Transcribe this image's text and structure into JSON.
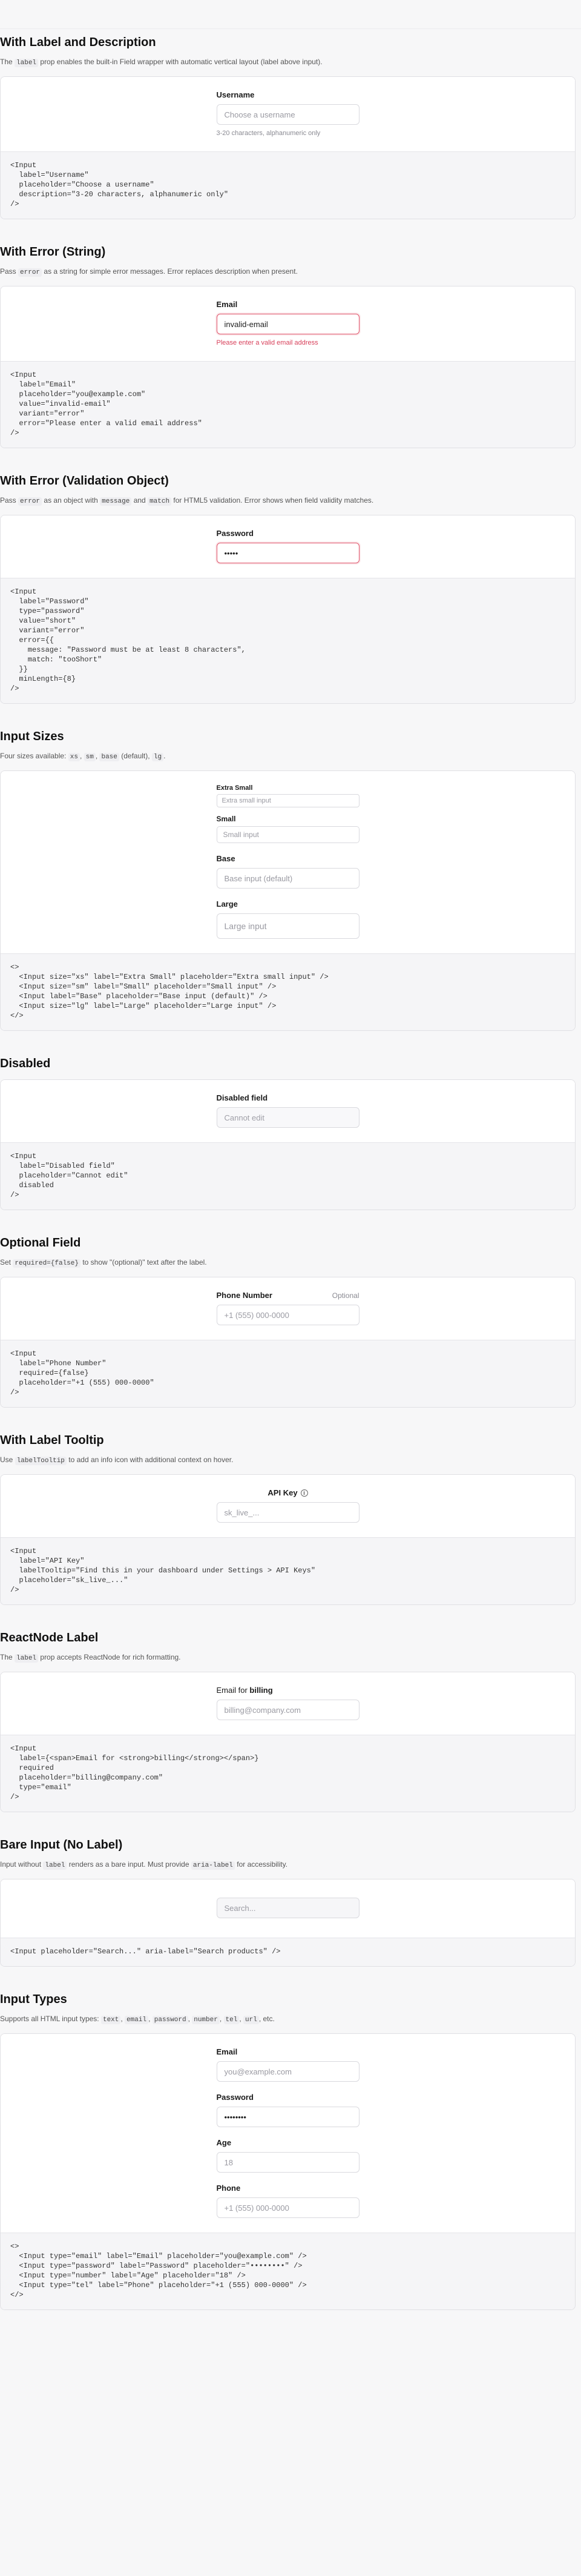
{
  "sections": {
    "label_desc": {
      "title": "With Label and Description",
      "desc_pre": "The",
      "desc_code": "label",
      "desc_post": "prop enables the built-in Field wrapper with automatic vertical layout (label above input).",
      "label": "Username",
      "placeholder": "Choose a username",
      "hint": "3-20 characters, alphanumeric only",
      "code": [
        "<Input",
        "  label=\"Username\"",
        "  placeholder=\"Choose a username\"",
        "  description=\"3-20 characters, alphanumeric only\"",
        "/>"
      ]
    },
    "error_string": {
      "title": "With Error (String)",
      "desc_pre": "Pass",
      "desc_code": "error",
      "desc_post": "as a string for simple error messages. Error replaces description when present.",
      "label": "Email",
      "value": "invalid-email",
      "error": "Please enter a valid email address",
      "code": [
        "<Input",
        "  label=\"Email\"",
        "  placeholder=\"you@example.com\"",
        "  value=\"invalid-email\"",
        "  variant=\"error\"",
        "  error=\"Please enter a valid email address\"",
        "/>"
      ]
    },
    "error_object": {
      "title": "With Error (Validation Object)",
      "desc_pre": "Pass",
      "desc_code": "error",
      "desc_mid1": "as an object with",
      "desc_code2": "message",
      "desc_mid2": "and",
      "desc_code3": "match",
      "desc_post": "for HTML5 validation. Error shows when field validity matches.",
      "label": "Password",
      "value": "•••••",
      "code": [
        "<Input",
        "  label=\"Password\"",
        "  type=\"password\"",
        "  value=\"short\"",
        "  variant=\"error\"",
        "  error={{",
        "    message: \"Password must be at least 8 characters\",",
        "    match: \"tooShort\"",
        "  }}",
        "  minLength={8}",
        "/>"
      ]
    },
    "sizes": {
      "title": "Input Sizes",
      "desc_pre": "Four sizes available:",
      "desc_c1": "xs",
      "desc_c2": "sm",
      "desc_c3": "base",
      "desc_mid": "(default),",
      "desc_c4": "lg",
      "desc_post": ".",
      "xs_label": "Extra Small",
      "xs_placeholder": "Extra small input",
      "sm_label": "Small",
      "sm_placeholder": "Small input",
      "base_label": "Base",
      "base_placeholder": "Base input (default)",
      "lg_label": "Large",
      "lg_placeholder": "Large input",
      "code": [
        "<>",
        "  <Input size=\"xs\" label=\"Extra Small\" placeholder=\"Extra small input\" />",
        "  <Input size=\"sm\" label=\"Small\" placeholder=\"Small input\" />",
        "  <Input label=\"Base\" placeholder=\"Base input (default)\" />",
        "  <Input size=\"lg\" label=\"Large\" placeholder=\"Large input\" />",
        "</>"
      ]
    },
    "disabled": {
      "title": "Disabled",
      "label": "Disabled field",
      "placeholder": "Cannot edit",
      "code": [
        "<Input",
        "  label=\"Disabled field\"",
        "  placeholder=\"Cannot edit\"",
        "  disabled",
        "/>"
      ]
    },
    "optional": {
      "title": "Optional Field",
      "desc_pre": "Set",
      "desc_code": "required={false}",
      "desc_post": "to show \"(optional)\" text after the label.",
      "label": "Phone Number",
      "optional_text": "Optional",
      "placeholder": "+1 (555) 000-0000",
      "code": [
        "<Input",
        "  label=\"Phone Number\"",
        "  required={false}",
        "  placeholder=\"+1 (555) 000-0000\"",
        "/>"
      ]
    },
    "tooltip": {
      "title": "With Label Tooltip",
      "desc_pre": "Use",
      "desc_code": "labelTooltip",
      "desc_post": "to add an info icon with additional context on hover.",
      "label": "API Key",
      "placeholder": "sk_live_...",
      "code": [
        "<Input",
        "  label=\"API Key\"",
        "  labelTooltip=\"Find this in your dashboard under Settings > API Keys\"",
        "  placeholder=\"sk_live_...\"",
        "/>"
      ]
    },
    "reactnode": {
      "title": "ReactNode Label",
      "desc_pre": "The",
      "desc_code": "label",
      "desc_post": "prop accepts ReactNode for rich formatting.",
      "label_pre": "Email for",
      "label_strong": "billing",
      "placeholder": "billing@company.com",
      "code": [
        "<Input",
        "  label={<span>Email for <strong>billing</strong></span>}",
        "  required",
        "  placeholder=\"billing@company.com\"",
        "  type=\"email\"",
        "/>"
      ]
    },
    "bare": {
      "title": "Bare Input (No Label)",
      "desc_pre": "Input without",
      "desc_code": "label",
      "desc_mid": "renders as a bare input. Must provide",
      "desc_code2": "aria-label",
      "desc_post": "for accessibility.",
      "placeholder": "Search...",
      "code": [
        "<Input placeholder=\"Search...\" aria-label=\"Search products\" />"
      ]
    },
    "types": {
      "title": "Input Types",
      "desc_pre": "Supports all HTML input types:",
      "desc_c1": "text",
      "desc_c2": "email",
      "desc_c3": "password",
      "desc_c4": "number",
      "desc_c5": "tel",
      "desc_c6": "url",
      "desc_post": ", etc.",
      "email_label": "Email",
      "email_placeholder": "you@example.com",
      "password_label": "Password",
      "password_value": "••••••••",
      "age_label": "Age",
      "age_placeholder": "18",
      "phone_label": "Phone",
      "phone_placeholder": "+1 (555) 000-0000",
      "code": [
        "<>",
        "  <Input type=\"email\" label=\"Email\" placeholder=\"you@example.com\" />",
        "  <Input type=\"password\" label=\"Password\" placeholder=\"••••••••\" />",
        "  <Input type=\"number\" label=\"Age\" placeholder=\"18\" />",
        "  <Input type=\"tel\" label=\"Phone\" placeholder=\"+1 (555) 000-0000\" />",
        "</>"
      ]
    }
  },
  "colors": {
    "error": "#d8415b",
    "code_tag": "#2f3fb0",
    "code_string": "#1f3c8f"
  }
}
